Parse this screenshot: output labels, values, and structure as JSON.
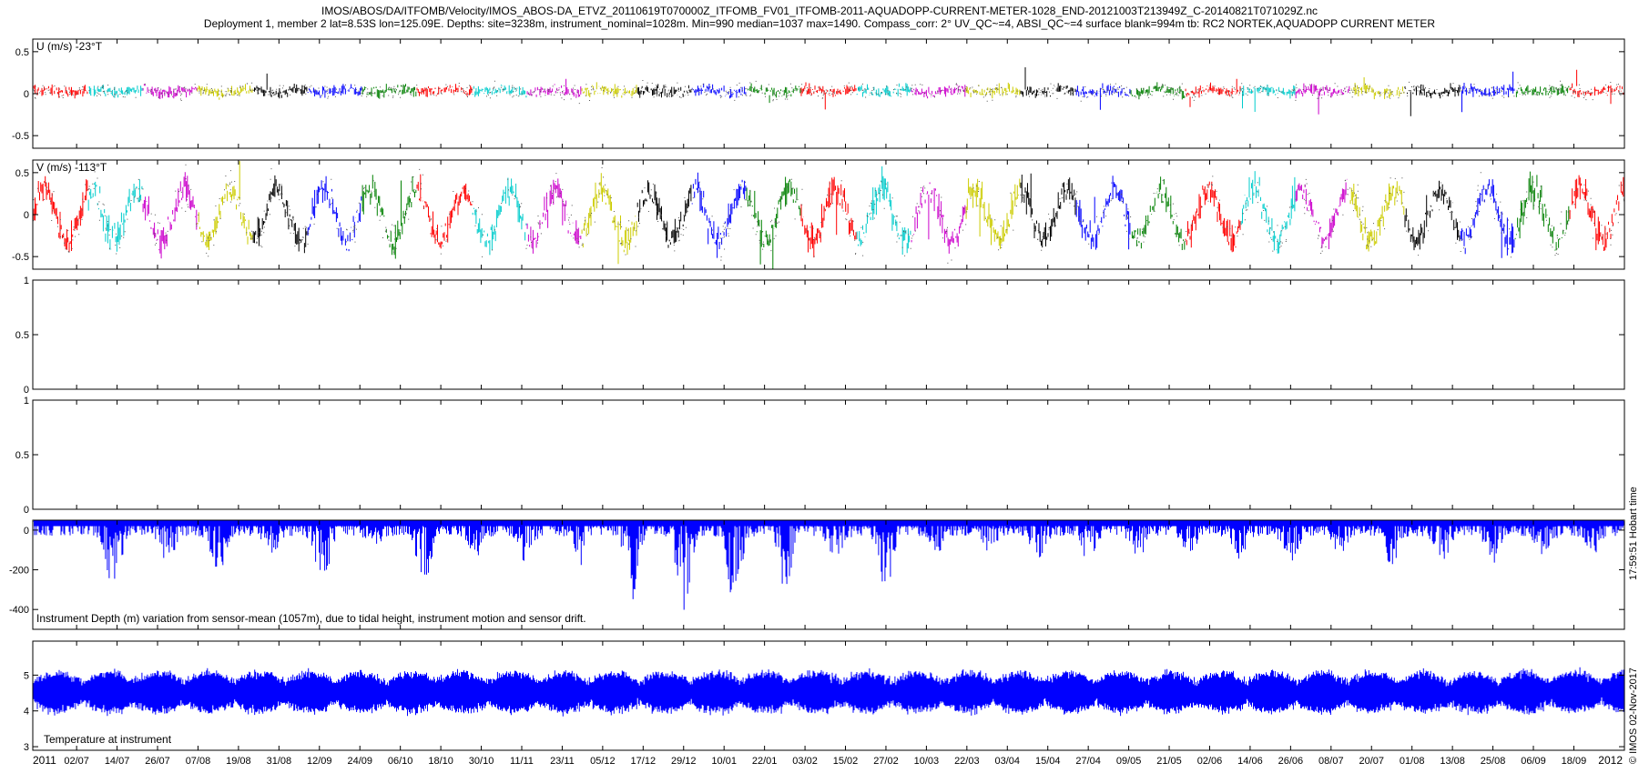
{
  "header": {
    "line1": "IMOS/ABOS/DA/ITFOMB/Velocity/IMOS_ABOS-DA_ETVZ_20110619T070000Z_ITFOMB_FV01_ITFOMB-2011-AQUADOPP-CURRENT-METER-1028_END-20121003T213949Z_C-20140821T071029Z.nc",
    "line2": "Deployment 1, member 2 lat=8.53S lon=125.09E. Depths: site=3238m, instrument_nominal=1028m. Min=990 median=1037 max=1490. Compass_corr: 2° UV_QC~=4, ABSI_QC~=4 surface blank=994m tb: RC2 NORTEK,AQUADOPP CURRENT METER"
  },
  "stamps": {
    "hobart": "17:59:51 Hobart time",
    "imos": "© IMOS 02-Nov-2017"
  },
  "colors": {
    "blue": "#0000ff",
    "cycle": [
      "#ff0000",
      "#00cccc",
      "#cc00cc",
      "#cccc00",
      "#000000",
      "#0000ff",
      "#008000"
    ]
  },
  "chart_data": [
    {
      "type": "line",
      "id": "u",
      "label": "U (m/s) -23°T",
      "ylim": [
        -0.65,
        0.65
      ],
      "yticks": [
        -0.5,
        0,
        0.5
      ],
      "ytick_labels": [
        "-0.5",
        "0",
        "0.5"
      ],
      "signal": {
        "kind": "velocity",
        "base": 0.03,
        "amp": 0.02,
        "period_days": 15,
        "noise": 0.06,
        "spike": 0.32
      }
    },
    {
      "type": "line",
      "id": "v",
      "label": "V (m/s) -113°T",
      "ylim": [
        -0.65,
        0.65
      ],
      "yticks": [
        -0.5,
        0,
        0.5
      ],
      "ytick_labels": [
        "-0.5",
        "0",
        "0.5"
      ],
      "signal": {
        "kind": "velocity",
        "base": 0.0,
        "amp": 0.3,
        "period_days": 13.8,
        "noise": 0.16,
        "spike": 0.6
      }
    },
    {
      "type": "line",
      "id": "empty1",
      "label": "",
      "ylim": [
        0,
        1
      ],
      "yticks": [
        0,
        0.5,
        1
      ],
      "ytick_labels": [
        "0",
        "0.5",
        "1"
      ]
    },
    {
      "type": "line",
      "id": "empty2",
      "label": "",
      "ylim": [
        0,
        1
      ],
      "yticks": [
        0,
        0.5,
        1
      ],
      "ytick_labels": [
        "0",
        "0.5",
        "1"
      ]
    },
    {
      "type": "line",
      "id": "depth",
      "label": "Instrument Depth (m) variation from sensor-mean (1057m), due to tidal height, instrument motion and sensor drift.",
      "ylim": [
        -500,
        50
      ],
      "yticks": [
        -400,
        -200,
        0
      ],
      "ytick_labels": [
        "-400",
        "-200",
        "0"
      ],
      "signal": {
        "kind": "depth",
        "top": 45,
        "events": [
          {
            "day": 24,
            "depth": -295
          },
          {
            "day": 40,
            "depth": -150
          },
          {
            "day": 55,
            "depth": -195
          },
          {
            "day": 71,
            "depth": -90
          },
          {
            "day": 86,
            "depth": -260
          },
          {
            "day": 101,
            "depth": -60
          },
          {
            "day": 116,
            "depth": -260
          },
          {
            "day": 131,
            "depth": -120
          },
          {
            "day": 146,
            "depth": -130
          },
          {
            "day": 162,
            "depth": -170
          },
          {
            "day": 178,
            "depth": -340
          },
          {
            "day": 193,
            "depth": -420
          },
          {
            "day": 208,
            "depth": -370
          },
          {
            "day": 223,
            "depth": -290
          },
          {
            "day": 238,
            "depth": -150
          },
          {
            "day": 253,
            "depth": -340
          },
          {
            "day": 268,
            "depth": -90
          },
          {
            "day": 283,
            "depth": -110
          },
          {
            "day": 298,
            "depth": -120
          },
          {
            "day": 313,
            "depth": -130
          },
          {
            "day": 328,
            "depth": -110
          },
          {
            "day": 343,
            "depth": -100
          },
          {
            "day": 358,
            "depth": -120
          },
          {
            "day": 373,
            "depth": -180
          },
          {
            "day": 388,
            "depth": -120
          },
          {
            "day": 403,
            "depth": -150
          },
          {
            "day": 418,
            "depth": -130
          },
          {
            "day": 433,
            "depth": -140
          },
          {
            "day": 448,
            "depth": -120
          },
          {
            "day": 463,
            "depth": -100
          }
        ]
      }
    },
    {
      "type": "line",
      "id": "temp",
      "label": "Temperature at instrument",
      "ylim": [
        2.9,
        5.95
      ],
      "yticks": [
        3,
        4,
        5
      ],
      "ytick_labels": [
        "3",
        "4",
        "5"
      ],
      "signal": {
        "kind": "temp",
        "mean": 4.5,
        "amp": 0.55,
        "env_period_days": 15,
        "noise": 0.18
      }
    }
  ],
  "x_axis": {
    "start_date": "2011-06-19",
    "end_date": "2012-10-03",
    "year_labels": [
      {
        "label": "2011",
        "date": "2011-06-19"
      },
      {
        "label": "2012",
        "date": "2012-10-03"
      }
    ],
    "tick_labels": [
      {
        "date": "2011-07-02",
        "label": "02/07"
      },
      {
        "date": "2011-07-14",
        "label": "14/07"
      },
      {
        "date": "2011-07-26",
        "label": "26/07"
      },
      {
        "date": "2011-08-07",
        "label": "07/08"
      },
      {
        "date": "2011-08-19",
        "label": "19/08"
      },
      {
        "date": "2011-08-31",
        "label": "31/08"
      },
      {
        "date": "2011-09-12",
        "label": "12/09"
      },
      {
        "date": "2011-09-24",
        "label": "24/09"
      },
      {
        "date": "2011-10-06",
        "label": "06/10"
      },
      {
        "date": "2011-10-18",
        "label": "18/10"
      },
      {
        "date": "2011-10-30",
        "label": "30/10"
      },
      {
        "date": "2011-11-11",
        "label": "11/11"
      },
      {
        "date": "2011-11-23",
        "label": "23/11"
      },
      {
        "date": "2011-12-05",
        "label": "05/12"
      },
      {
        "date": "2011-12-17",
        "label": "17/12"
      },
      {
        "date": "2011-12-29",
        "label": "29/12"
      },
      {
        "date": "2012-01-10",
        "label": "10/01"
      },
      {
        "date": "2012-01-22",
        "label": "22/01"
      },
      {
        "date": "2012-02-03",
        "label": "03/02"
      },
      {
        "date": "2012-02-15",
        "label": "15/02"
      },
      {
        "date": "2012-02-27",
        "label": "27/02"
      },
      {
        "date": "2012-03-10",
        "label": "10/03"
      },
      {
        "date": "2012-03-22",
        "label": "22/03"
      },
      {
        "date": "2012-04-03",
        "label": "03/04"
      },
      {
        "date": "2012-04-15",
        "label": "15/04"
      },
      {
        "date": "2012-04-27",
        "label": "27/04"
      },
      {
        "date": "2012-05-09",
        "label": "09/05"
      },
      {
        "date": "2012-05-21",
        "label": "21/05"
      },
      {
        "date": "2012-06-02",
        "label": "02/06"
      },
      {
        "date": "2012-06-14",
        "label": "14/06"
      },
      {
        "date": "2012-06-26",
        "label": "26/06"
      },
      {
        "date": "2012-07-08",
        "label": "08/07"
      },
      {
        "date": "2012-07-20",
        "label": "20/07"
      },
      {
        "date": "2012-08-01",
        "label": "01/08"
      },
      {
        "date": "2012-08-13",
        "label": "13/08"
      },
      {
        "date": "2012-08-25",
        "label": "25/08"
      },
      {
        "date": "2012-09-06",
        "label": "06/09"
      },
      {
        "date": "2012-09-18",
        "label": "18/09"
      }
    ]
  }
}
